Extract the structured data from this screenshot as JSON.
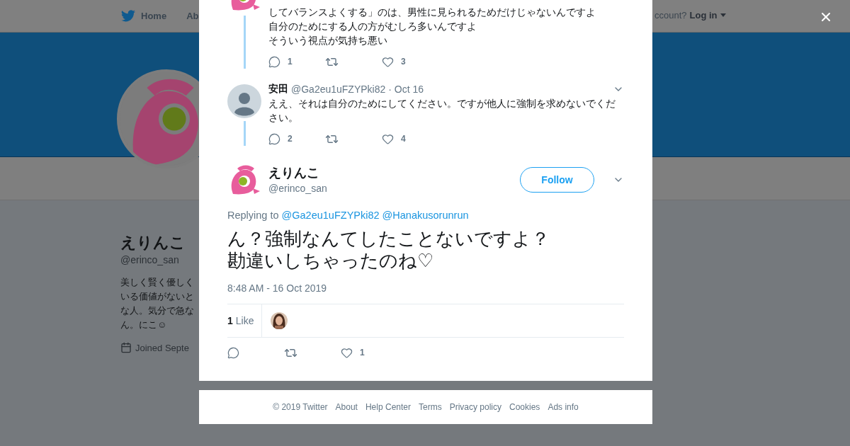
{
  "background_page": {
    "nav": {
      "items": [
        "Home",
        "Ab"
      ],
      "account_prompt": "ccount?",
      "login": "Log in"
    },
    "profile": {
      "name": "えりんこ",
      "handle": "@erinco_san",
      "bio": [
        "美しく賢く優しく",
        "いる価値がないと",
        "な人。気分で急な",
        "ん。にこ☺"
      ],
      "joined": "Joined Septe"
    }
  },
  "dialog": {
    "thread": [
      {
        "lines": [
          "してバランスよくする」のは、男性に見られるためだけじゃないんですよ",
          "自分のためにする人の方がむしろ多いんですよ",
          "そういう視点が気持ち悪い"
        ],
        "replies": "1",
        "likes": "3"
      },
      {
        "name": "安田",
        "handle": "@Ga2eu1uFZYPki82",
        "date": "· Oct 16",
        "lines": [
          "ええ、それは自分のためにしてください。ですが他人に強制を求めないでください。"
        ],
        "replies": "2",
        "likes": "4"
      }
    ],
    "tweet": {
      "name": "えりんこ",
      "handle": "@erinco_san",
      "follow": "Follow",
      "replying_label": "Replying to",
      "replying_to": [
        "@Ga2eu1uFZYPki82",
        "@Hanakusorunrun"
      ],
      "lines": [
        "ん？強制なんてしたことないですよ？",
        "勘違いしちゃったのね♡"
      ],
      "time": "8:48 AM - 16 Oct 2019",
      "like_count": "1",
      "like_label": "Like",
      "likes": "1"
    }
  },
  "footer": {
    "links": [
      "© 2019 Twitter",
      "About",
      "Help Center",
      "Terms",
      "Privacy policy",
      "Cookies",
      "Ads info"
    ]
  }
}
